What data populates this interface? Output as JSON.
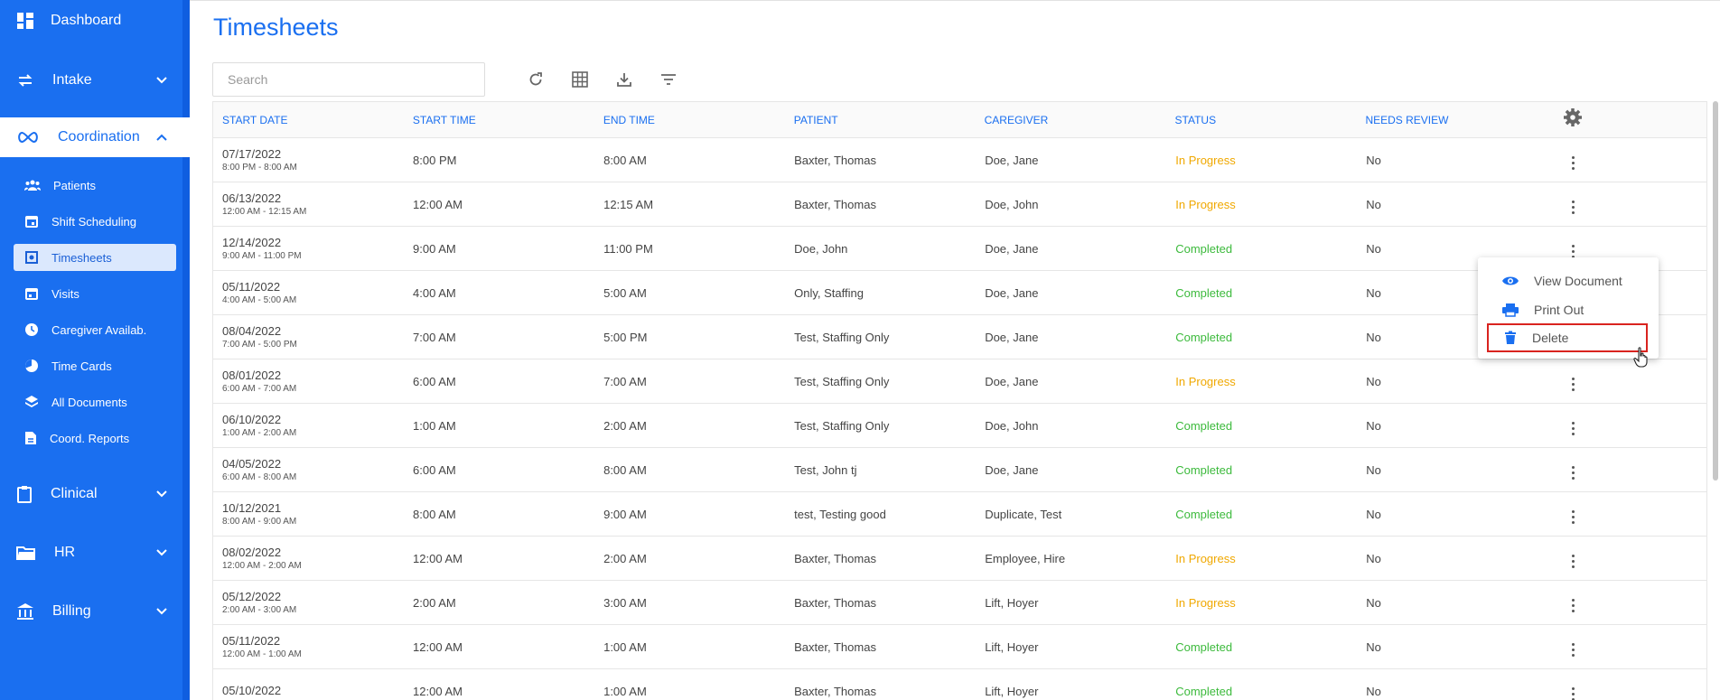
{
  "sidebar": {
    "dashboard": "Dashboard",
    "intake": "Intake",
    "coordination": "Coordination",
    "items": [
      {
        "label": "Patients",
        "icon": "people-icon"
      },
      {
        "label": "Shift Scheduling",
        "icon": "calendar-icon"
      },
      {
        "label": "Timesheets",
        "icon": "timesheet-icon"
      },
      {
        "label": "Visits",
        "icon": "calendar-check-icon"
      },
      {
        "label": "Caregiver Availab.",
        "icon": "clock-icon"
      },
      {
        "label": "Time Cards",
        "icon": "pie-icon"
      },
      {
        "label": "All Documents",
        "icon": "layers-icon"
      },
      {
        "label": "Coord. Reports",
        "icon": "document-icon"
      }
    ],
    "clinical": "Clinical",
    "hr": "HR",
    "billing": "Billing",
    "accent": "#1a6ff0"
  },
  "page": {
    "title": "Timesheets",
    "search_placeholder": "Search"
  },
  "table": {
    "headers": [
      "START DATE",
      "START TIME",
      "END TIME",
      "PATIENT",
      "CAREGIVER",
      "STATUS",
      "NEEDS REVIEW"
    ],
    "rows": [
      {
        "date": "07/17/2022",
        "range": "8:00 PM - 8:00 AM",
        "start": "8:00 PM",
        "end": "8:00 AM",
        "patient": "Baxter, Thomas",
        "caregiver": "Doe, Jane",
        "status": "In Progress",
        "review": "No"
      },
      {
        "date": "06/13/2022",
        "range": "12:00 AM - 12:15 AM",
        "start": "12:00 AM",
        "end": "12:15 AM",
        "patient": "Baxter, Thomas",
        "caregiver": "Doe, John",
        "status": "In Progress",
        "review": "No"
      },
      {
        "date": "12/14/2022",
        "range": "9:00 AM - 11:00 PM",
        "start": "9:00 AM",
        "end": "11:00 PM",
        "patient": "Doe, John",
        "caregiver": "Doe, Jane",
        "status": "Completed",
        "review": "No"
      },
      {
        "date": "05/11/2022",
        "range": "4:00 AM - 5:00 AM",
        "start": "4:00 AM",
        "end": "5:00 AM",
        "patient": "Only, Staffing",
        "caregiver": "Doe, Jane",
        "status": "Completed",
        "review": "No"
      },
      {
        "date": "08/04/2022",
        "range": "7:00 AM - 5:00 PM",
        "start": "7:00 AM",
        "end": "5:00 PM",
        "patient": "Test, Staffing Only",
        "caregiver": "Doe, Jane",
        "status": "Completed",
        "review": "No"
      },
      {
        "date": "08/01/2022",
        "range": "6:00 AM - 7:00 AM",
        "start": "6:00 AM",
        "end": "7:00 AM",
        "patient": "Test, Staffing Only",
        "caregiver": "Doe, Jane",
        "status": "In Progress",
        "review": "No"
      },
      {
        "date": "06/10/2022",
        "range": "1:00 AM - 2:00 AM",
        "start": "1:00 AM",
        "end": "2:00 AM",
        "patient": "Test, Staffing Only",
        "caregiver": "Doe, John",
        "status": "Completed",
        "review": "No"
      },
      {
        "date": "04/05/2022",
        "range": "6:00 AM - 8:00 AM",
        "start": "6:00 AM",
        "end": "8:00 AM",
        "patient": "Test, John tj",
        "caregiver": "Doe, Jane",
        "status": "Completed",
        "review": "No"
      },
      {
        "date": "10/12/2021",
        "range": "8:00 AM - 9:00 AM",
        "start": "8:00 AM",
        "end": "9:00 AM",
        "patient": "test, Testing good",
        "caregiver": "Duplicate, Test",
        "status": "Completed",
        "review": "No"
      },
      {
        "date": "08/02/2022",
        "range": "12:00 AM - 2:00 AM",
        "start": "12:00 AM",
        "end": "2:00 AM",
        "patient": "Baxter, Thomas",
        "caregiver": "Employee, Hire",
        "status": "In Progress",
        "review": "No"
      },
      {
        "date": "05/12/2022",
        "range": "2:00 AM - 3:00 AM",
        "start": "2:00 AM",
        "end": "3:00 AM",
        "patient": "Baxter, Thomas",
        "caregiver": "Lift, Hoyer",
        "status": "In Progress",
        "review": "No"
      },
      {
        "date": "05/11/2022",
        "range": "12:00 AM - 1:00 AM",
        "start": "12:00 AM",
        "end": "1:00 AM",
        "patient": "Baxter, Thomas",
        "caregiver": "Lift, Hoyer",
        "status": "Completed",
        "review": "No"
      },
      {
        "date": "05/10/2022",
        "range": "",
        "start": "12:00 AM",
        "end": "1:00 AM",
        "patient": "Baxter, Thomas",
        "caregiver": "Lift, Hoyer",
        "status": "Completed",
        "review": "No"
      }
    ]
  },
  "context_menu": {
    "view": "View Document",
    "print": "Print Out",
    "delete": "Delete"
  },
  "colors": {
    "in_progress": "#f0a800",
    "completed": "#3cba3c",
    "highlight": "#d9231f"
  }
}
